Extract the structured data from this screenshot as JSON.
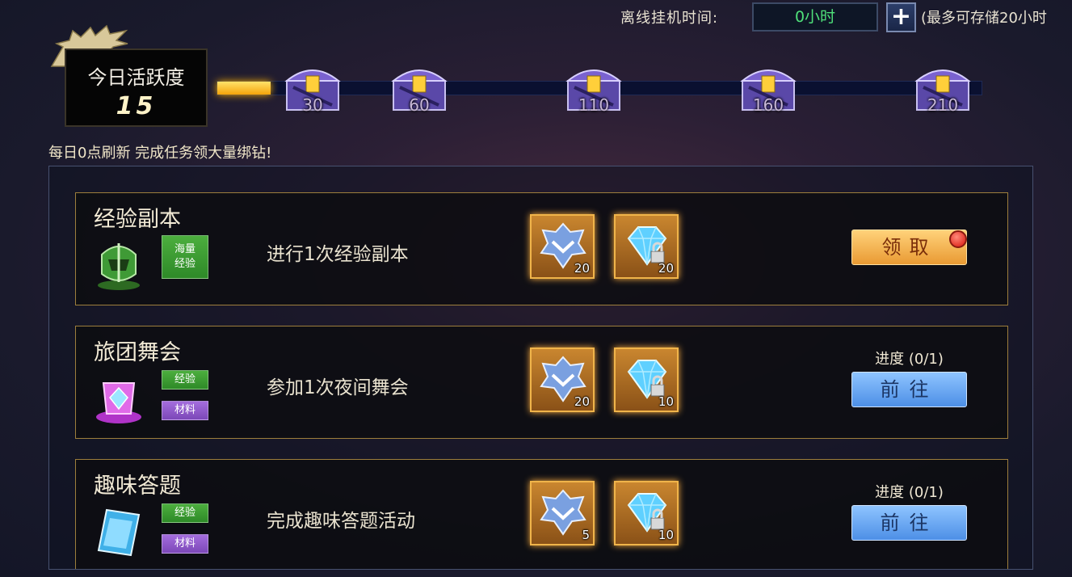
{
  "offline": {
    "label": "离线挂机时间:",
    "value": "0小时",
    "plus": "+",
    "note": "(最多可存储20小时"
  },
  "activity": {
    "title": "今日活跃度",
    "score": "15",
    "refresh_tip": "每日0点刷新 完成任务领大量绑钻!",
    "progress": 0.07,
    "chests": [
      {
        "value": "30"
      },
      {
        "value": "60"
      },
      {
        "value": "110"
      },
      {
        "value": "160"
      },
      {
        "value": "210"
      }
    ]
  },
  "tasks": [
    {
      "name": "经验副本",
      "icon": "helmet-icon",
      "tags": [
        "海量\n经验"
      ],
      "description": "进行1次经验副本",
      "rewards": [
        {
          "icon": "activity-badge-icon",
          "count": "20"
        },
        {
          "icon": "locked-diamond-icon",
          "count": "20"
        }
      ],
      "button": "领取",
      "state": "claim"
    },
    {
      "name": "旅团舞会",
      "icon": "dance-gem-icon",
      "tags": [
        "经验",
        "材料"
      ],
      "description": "参加1次夜间舞会",
      "rewards": [
        {
          "icon": "activity-badge-icon",
          "count": "20"
        },
        {
          "icon": "locked-diamond-icon",
          "count": "10"
        }
      ],
      "progress": "进度 (0/1)",
      "button": "前往",
      "state": "goto"
    },
    {
      "name": "趣味答题",
      "icon": "quiz-card-icon",
      "tags": [
        "经验",
        "材料"
      ],
      "description": "完成趣味答题活动",
      "rewards": [
        {
          "icon": "activity-badge-icon",
          "count": "5"
        },
        {
          "icon": "locked-diamond-icon",
          "count": "10"
        }
      ],
      "progress": "进度 (0/1)",
      "button": "前往",
      "state": "goto"
    }
  ],
  "colors": {
    "accent_gold": "#f0b44a",
    "claim_orange": "#e99a33",
    "goto_blue": "#4d8fe6",
    "tag_green": "#2e8a28",
    "tag_purple": "#7c48b8",
    "offline_value_green": "#4fe07a"
  }
}
